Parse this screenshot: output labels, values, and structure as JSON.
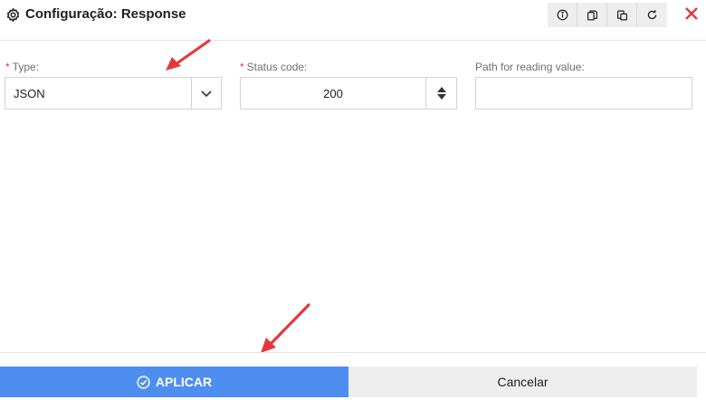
{
  "header": {
    "title": "Configuração: Response",
    "toolbar_icons": [
      "info-icon",
      "copy-icon",
      "paste-icon",
      "refresh-icon"
    ],
    "close_icon": "close-icon",
    "close_color": "#e4393c"
  },
  "form": {
    "type": {
      "required_mark": "*",
      "label": "Type:",
      "value": "JSON"
    },
    "status_code": {
      "required_mark": "*",
      "label": "Status code:",
      "value": "200"
    },
    "path": {
      "label": "Path for reading value:",
      "value": ""
    }
  },
  "footer": {
    "apply_label": "APLICAR",
    "cancel_label": "Cancelar",
    "apply_color": "#4d8ef0"
  },
  "annotations": {
    "arrow_color": "#e4393c"
  }
}
